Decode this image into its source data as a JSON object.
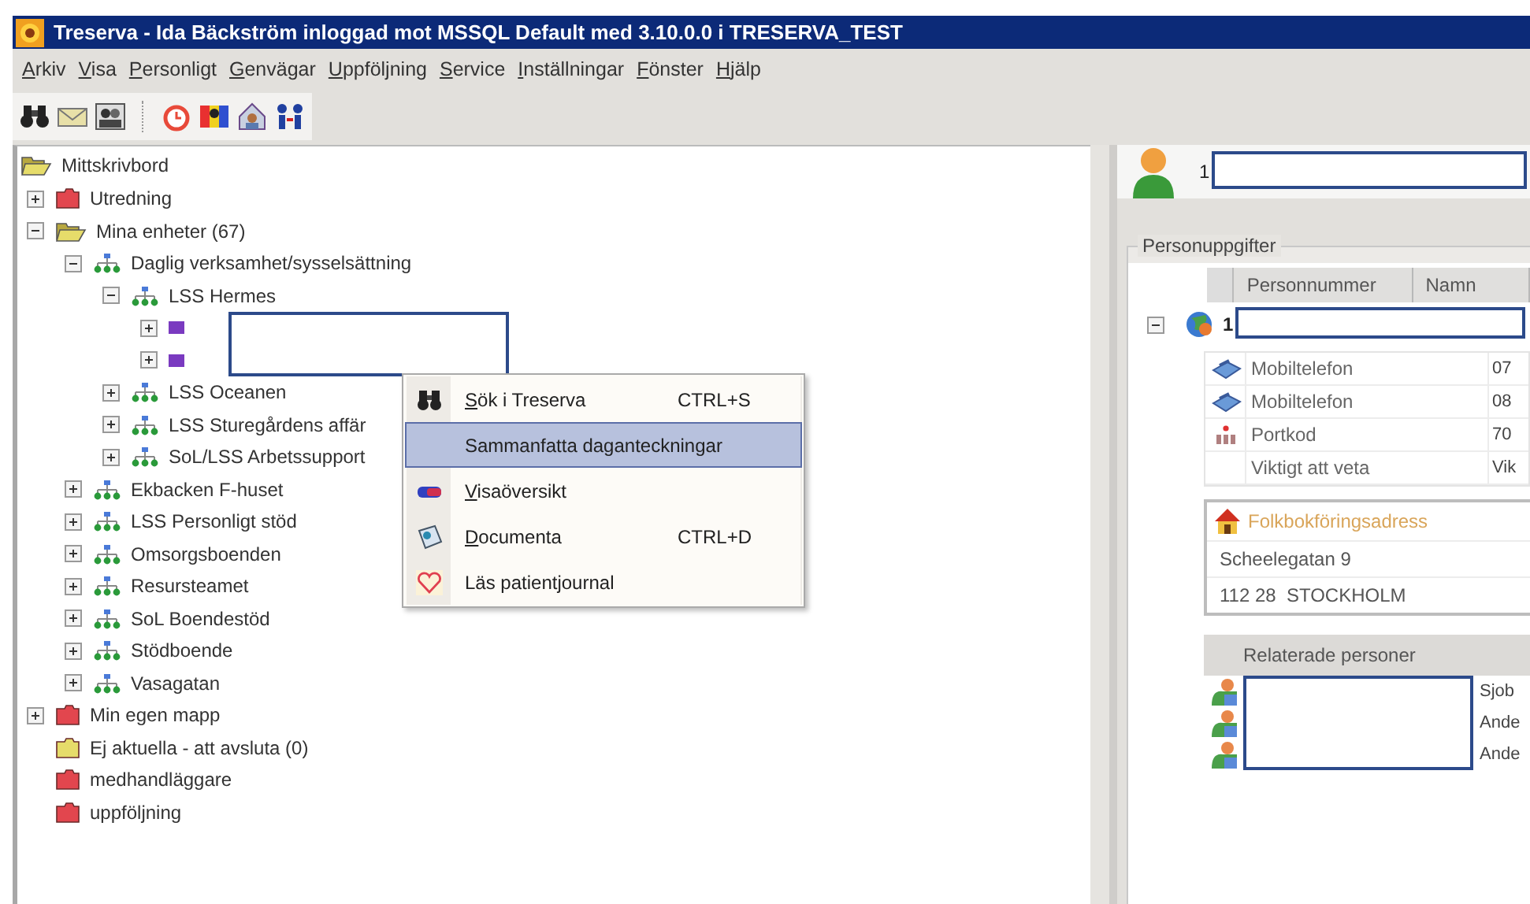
{
  "window": {
    "title": "Treserva - Ida Bäckström inloggad mot MSSQL Default  med 3.10.0.0 i TRESERVA_TEST"
  },
  "menu": [
    {
      "label": "Arkiv",
      "underlined_initial": true
    },
    {
      "label": "Visa",
      "underlined_initial": true
    },
    {
      "label": "Personligt",
      "underlined_initial": true
    },
    {
      "label": "Genvägar",
      "underlined_initial": true
    },
    {
      "label": "Uppföljning",
      "underlined_initial": true
    },
    {
      "label": "Service",
      "underlined_initial": true
    },
    {
      "label": "Inställningar",
      "underlined_initial": true
    },
    {
      "label": "Fönster",
      "underlined_initial": true
    },
    {
      "label": "Hjälp",
      "underlined_initial": true
    }
  ],
  "tree": {
    "label": "Mittskrivbord",
    "kind": "open-folder",
    "color": "#e6dc6a",
    "children": [
      {
        "label": "Utredning",
        "kind": "folder",
        "color": "#e2464e",
        "expanded": false
      },
      {
        "label": "Mina enheter (67)",
        "kind": "open-folder",
        "color": "#e6dc6a",
        "expanded": true,
        "children": [
          {
            "label": "Daglig verksamhet/sysselsättning",
            "kind": "unit",
            "expanded": true,
            "children": [
              {
                "label": "LSS Hermes",
                "kind": "unit",
                "expanded": true,
                "children": [
                  {
                    "kind": "concealed",
                    "expanded": false
                  },
                  {
                    "kind": "concealed",
                    "expanded": false
                  }
                ]
              },
              {
                "label": "LSS Oceanen",
                "kind": "unit",
                "expanded": false
              },
              {
                "label": "LSS Sturegårdens affär",
                "kind": "unit",
                "expanded": false
              },
              {
                "label": "SoL/LSS Arbetssupport",
                "kind": "unit",
                "expanded": false
              }
            ]
          },
          {
            "label": "Ekbacken F-huset",
            "kind": "unit",
            "expanded": false
          },
          {
            "label": "LSS Personligt stöd",
            "kind": "unit",
            "expanded": false
          },
          {
            "label": "Omsorgsboenden",
            "kind": "unit",
            "expanded": false
          },
          {
            "label": "Resursteamet",
            "kind": "unit",
            "expanded": false
          },
          {
            "label": "SoL Boendestöd",
            "kind": "unit",
            "expanded": false
          },
          {
            "label": "Stödboende",
            "kind": "unit",
            "expanded": false
          },
          {
            "label": "Vasagatan",
            "kind": "unit",
            "expanded": false
          }
        ]
      },
      {
        "label": "Min egen mapp",
        "kind": "folder",
        "color": "#e2464e",
        "expanded": false
      },
      {
        "label": "Ej aktuella - att avsluta (0)",
        "kind": "folder",
        "color": "#e6dc6a"
      },
      {
        "label": "medhandläggare",
        "kind": "folder",
        "color": "#e2464e"
      },
      {
        "label": "uppföljning",
        "kind": "folder",
        "color": "#e2464e"
      }
    ]
  },
  "context_menu": [
    {
      "kind": "search",
      "label": "Sök i Treserva",
      "shortcut": "CTRL+S",
      "underlined_initial": true,
      "selected": false
    },
    {
      "kind": "summary",
      "label": "Sammanfatta daganteckningar",
      "underlined_initial": false,
      "selected": true
    },
    {
      "kind": "overview",
      "label": "Visaöversikt",
      "underlined_initial": true,
      "selected": false
    },
    {
      "kind": "documenta",
      "label": "Documenta",
      "shortcut": "CTRL+D",
      "underlined_initial": true,
      "selected": false
    },
    {
      "kind": "journal",
      "label": "Läs patientjournal",
      "underlined_initial": false,
      "selected": false
    }
  ],
  "person": {
    "name_start": "1"
  },
  "personuppgifter": {
    "title": "Personuppgifter",
    "columns": [
      "Personnummer",
      "Namn"
    ],
    "row": {
      "text": "1",
      "expanded": true
    },
    "details": [
      {
        "kind": "phone",
        "label": "Mobiltelefon",
        "value": "07"
      },
      {
        "kind": "phone",
        "label": "Mobiltelefon",
        "value": "08"
      },
      {
        "kind": "code",
        "label": "Portkod",
        "value": "70"
      },
      {
        "kind": "plain",
        "label": "Viktigt att veta",
        "value": "Vik"
      }
    ],
    "address": {
      "title": "Folkbokföringsadress",
      "lines": [
        "Scheelegatan 9",
        "112 28  STOCKHOLM"
      ]
    },
    "related": {
      "title": "Relaterade personer",
      "rows": [
        {
          "value": "Sjob"
        },
        {
          "value": "Ande"
        },
        {
          "value": "Ande"
        }
      ]
    }
  }
}
